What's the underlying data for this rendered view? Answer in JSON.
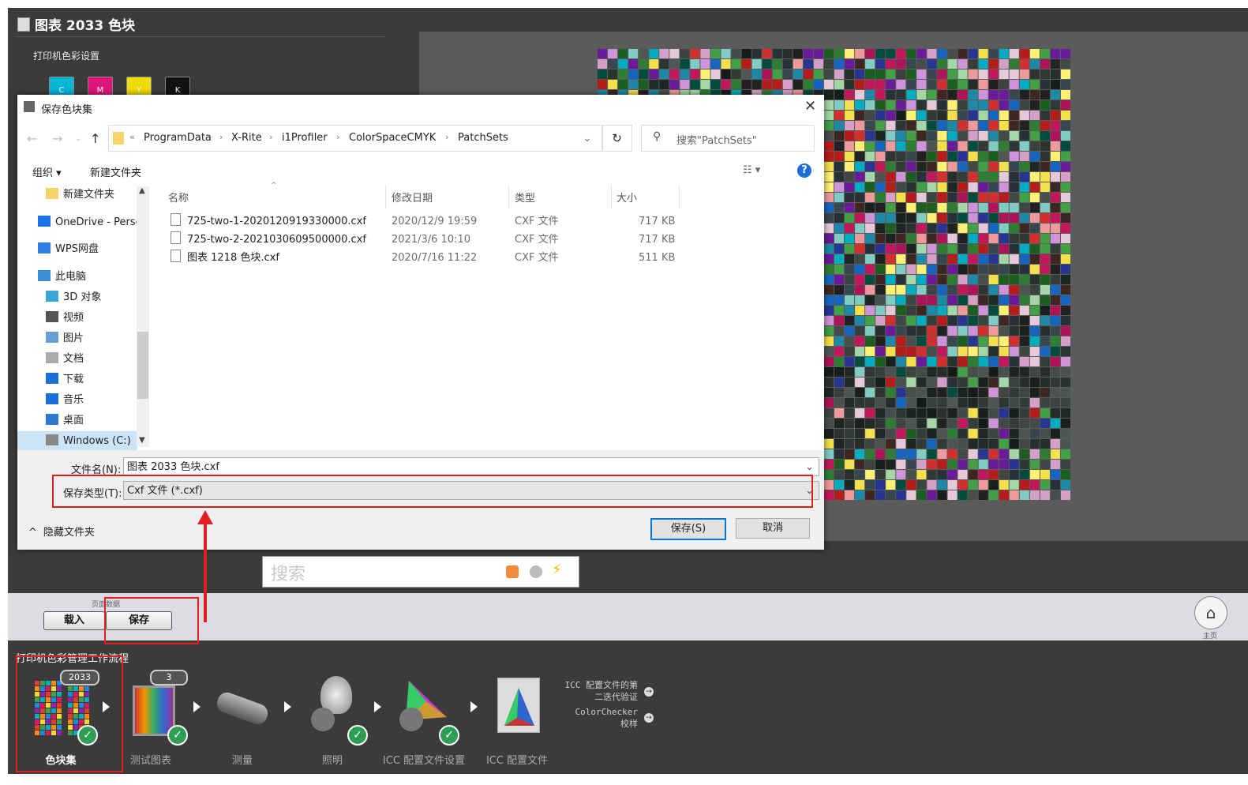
{
  "app": {
    "title": "图表 2033 色块",
    "printer_settings_label": "打印机色彩设置",
    "ink_swatches": [
      {
        "label": "C",
        "color": "#00b7d8"
      },
      {
        "label": "M",
        "color": "#e0157c"
      },
      {
        "label": "Y",
        "color": "#f0dc00"
      },
      {
        "label": "K",
        "color": "#111111"
      }
    ],
    "search_placeholder": "搜索",
    "strip_label": "页面数据",
    "load_button": "载入",
    "save_button": "保存",
    "home_label": "主页",
    "workflow_title": "打印机色彩管理工作流程",
    "workflow_steps": [
      {
        "label": "色块集",
        "badge": "2033"
      },
      {
        "label": "测试图表",
        "badge": "3"
      },
      {
        "label": "测量"
      },
      {
        "label": "照明"
      },
      {
        "label": "ICC 配置文件设置"
      },
      {
        "label": "ICC 配置文件"
      }
    ],
    "icc_links": [
      "ICC 配置文件的第二迭代验证",
      "ColorChecker 校样"
    ]
  },
  "dialog": {
    "title": "保存色块集",
    "close_icon": "close-icon",
    "breadcrumb": [
      "ProgramData",
      "X-Rite",
      "i1Profiler",
      "ColorSpaceCMYK",
      "PatchSets"
    ],
    "breadcrumb_prefix": "«",
    "search_placeholder": "搜索\"PatchSets\"",
    "organize_label": "组织 ▾",
    "new_folder_label": "新建文件夹",
    "nav_items": [
      {
        "label": "新建文件夹",
        "icon": "folder-icon"
      },
      {
        "label": "OneDrive - Perso",
        "icon": "onedrive-icon"
      },
      {
        "label": "WPS网盘",
        "icon": "cloud-icon"
      },
      {
        "label": "此电脑",
        "icon": "computer-icon"
      },
      {
        "label": "3D 对象",
        "icon": "cube-icon"
      },
      {
        "label": "视频",
        "icon": "video-icon"
      },
      {
        "label": "图片",
        "icon": "picture-icon"
      },
      {
        "label": "文档",
        "icon": "document-icon"
      },
      {
        "label": "下载",
        "icon": "download-icon"
      },
      {
        "label": "音乐",
        "icon": "music-icon"
      },
      {
        "label": "桌面",
        "icon": "desktop-icon"
      },
      {
        "label": "Windows (C:)",
        "icon": "drive-icon"
      }
    ],
    "columns": [
      "名称",
      "修改日期",
      "类型",
      "大小"
    ],
    "files": [
      {
        "name": "725-two-1-2020120919330000.cxf",
        "date": "2020/12/9 19:59",
        "type": "CXF 文件",
        "size": "717 KB"
      },
      {
        "name": "725-two-2-2021030609500000.cxf",
        "date": "2021/3/6 10:10",
        "type": "CXF 文件",
        "size": "717 KB"
      },
      {
        "name": "图表 1218 色块.cxf",
        "date": "2020/7/16 11:22",
        "type": "CXF 文件",
        "size": "511 KB"
      }
    ],
    "filename_label": "文件名(N):",
    "filename_value": "图表 2033 色块.cxf",
    "filetype_label": "保存类型(T):",
    "filetype_value": "Cxf 文件 (*.cxf)",
    "hide_folders_label": "隐藏文件夹",
    "save_label": "保存(S)",
    "cancel_label": "取消"
  },
  "colors": {
    "annotation_red": "#e02020",
    "accent_blue": "#0078d7",
    "background_dark": "#3b3b3b"
  }
}
